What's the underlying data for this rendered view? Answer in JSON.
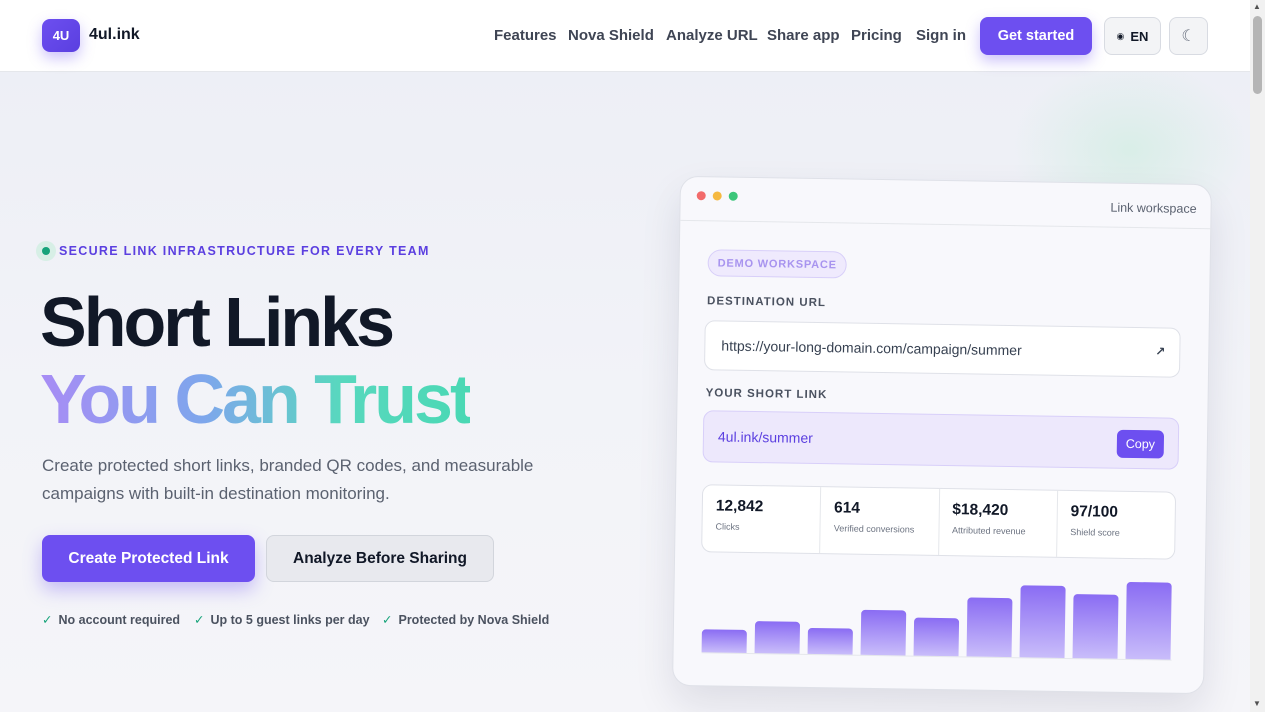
{
  "nav": {
    "logo_mark": "4U",
    "brand": "4ul.ink",
    "links": [
      "Features",
      "Nova Shield",
      "Analyze URL",
      "Share app",
      "Pricing",
      "Sign in"
    ],
    "cta": "Get started",
    "language": "EN",
    "theme_icon": "☾"
  },
  "hero": {
    "eyebrow": "SECURE LINK INFRASTRUCTURE FOR EVERY TEAM",
    "title_line1": "Short Links",
    "title_line2": "You Can Trust",
    "subtitle": "Create protected short links, branded QR codes, and measurable campaigns with built-in destination monitoring.",
    "primary_cta": "Create Protected Link",
    "secondary_cta": "Analyze Before Sharing",
    "perks": [
      "No account required",
      "Up to 5 guest links per day",
      "Protected by Nova Shield"
    ]
  },
  "workspace": {
    "title": "Link workspace",
    "badge": "DEMO WORKSPACE",
    "destination_label": "DESTINATION URL",
    "destination_value": "https://your-long-domain.com/campaign/summer",
    "short_label": "YOUR SHORT LINK",
    "short_value": "4ul.ink/summer",
    "copy_label": "Copy",
    "stats": [
      {
        "value": "12,842",
        "label": "Clicks"
      },
      {
        "value": "614",
        "label": "Verified conversions"
      },
      {
        "value": "$18,420",
        "label": "Attributed revenue"
      },
      {
        "value": "97/100",
        "label": "Shield score"
      }
    ],
    "bar_levels": [
      0.27,
      0.38,
      0.31,
      0.54,
      0.45,
      0.7,
      0.86,
      0.76,
      0.92
    ]
  },
  "colors": {
    "accent": "#6d4ff0",
    "success": "#16a37a",
    "traffic_red": "#f26b6b",
    "traffic_yellow": "#f5b941",
    "traffic_green": "#3cc67a"
  }
}
